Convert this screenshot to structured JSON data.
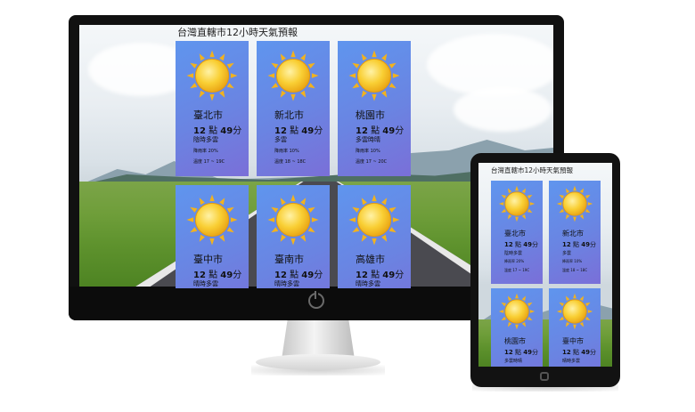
{
  "page_title": "台灣直轄市12小時天氣預報",
  "weather_icon": "sun-icon",
  "colors": {
    "card_top": "#5f95ee",
    "card_bottom": "#7a6fd8",
    "sun": "#f7c52c"
  },
  "monitor_cards": [
    {
      "city": "臺北市",
      "time_h": "12",
      "time_m": "49",
      "desc": "陰時多雲",
      "rain": "降雨率 20%",
      "temp": "溫度 17 ~ 19C"
    },
    {
      "city": "新北市",
      "time_h": "12",
      "time_m": "49",
      "desc": "多雲",
      "rain": "降雨率 10%",
      "temp": "溫度 18 ~ 18C"
    },
    {
      "city": "桃園市",
      "time_h": "12",
      "time_m": "49",
      "desc": "多雲時晴",
      "rain": "降雨率 10%",
      "temp": "溫度 17 ~ 20C"
    },
    {
      "city": "臺中市",
      "time_h": "12",
      "time_m": "49",
      "desc": "晴時多雲"
    },
    {
      "city": "臺南市",
      "time_h": "12",
      "time_m": "49",
      "desc": "晴時多雲"
    },
    {
      "city": "高雄市",
      "time_h": "12",
      "time_m": "49",
      "desc": "晴時多雲"
    }
  ],
  "tablet_cards": [
    {
      "city": "臺北市",
      "time_h": "12",
      "time_m": "49",
      "desc": "陰時多雲",
      "rain": "降雨率 20%",
      "temp": "溫度 17 ~ 19C"
    },
    {
      "city": "新北市",
      "time_h": "12",
      "time_m": "49",
      "desc": "多雲",
      "rain": "降雨率 10%",
      "temp": "溫度 18 ~ 18C"
    },
    {
      "city": "桃園市",
      "time_h": "12",
      "time_m": "49",
      "desc": "多雲時晴"
    },
    {
      "city": "臺中市",
      "time_h": "12",
      "time_m": "49",
      "desc": "晴時多雲"
    }
  ]
}
